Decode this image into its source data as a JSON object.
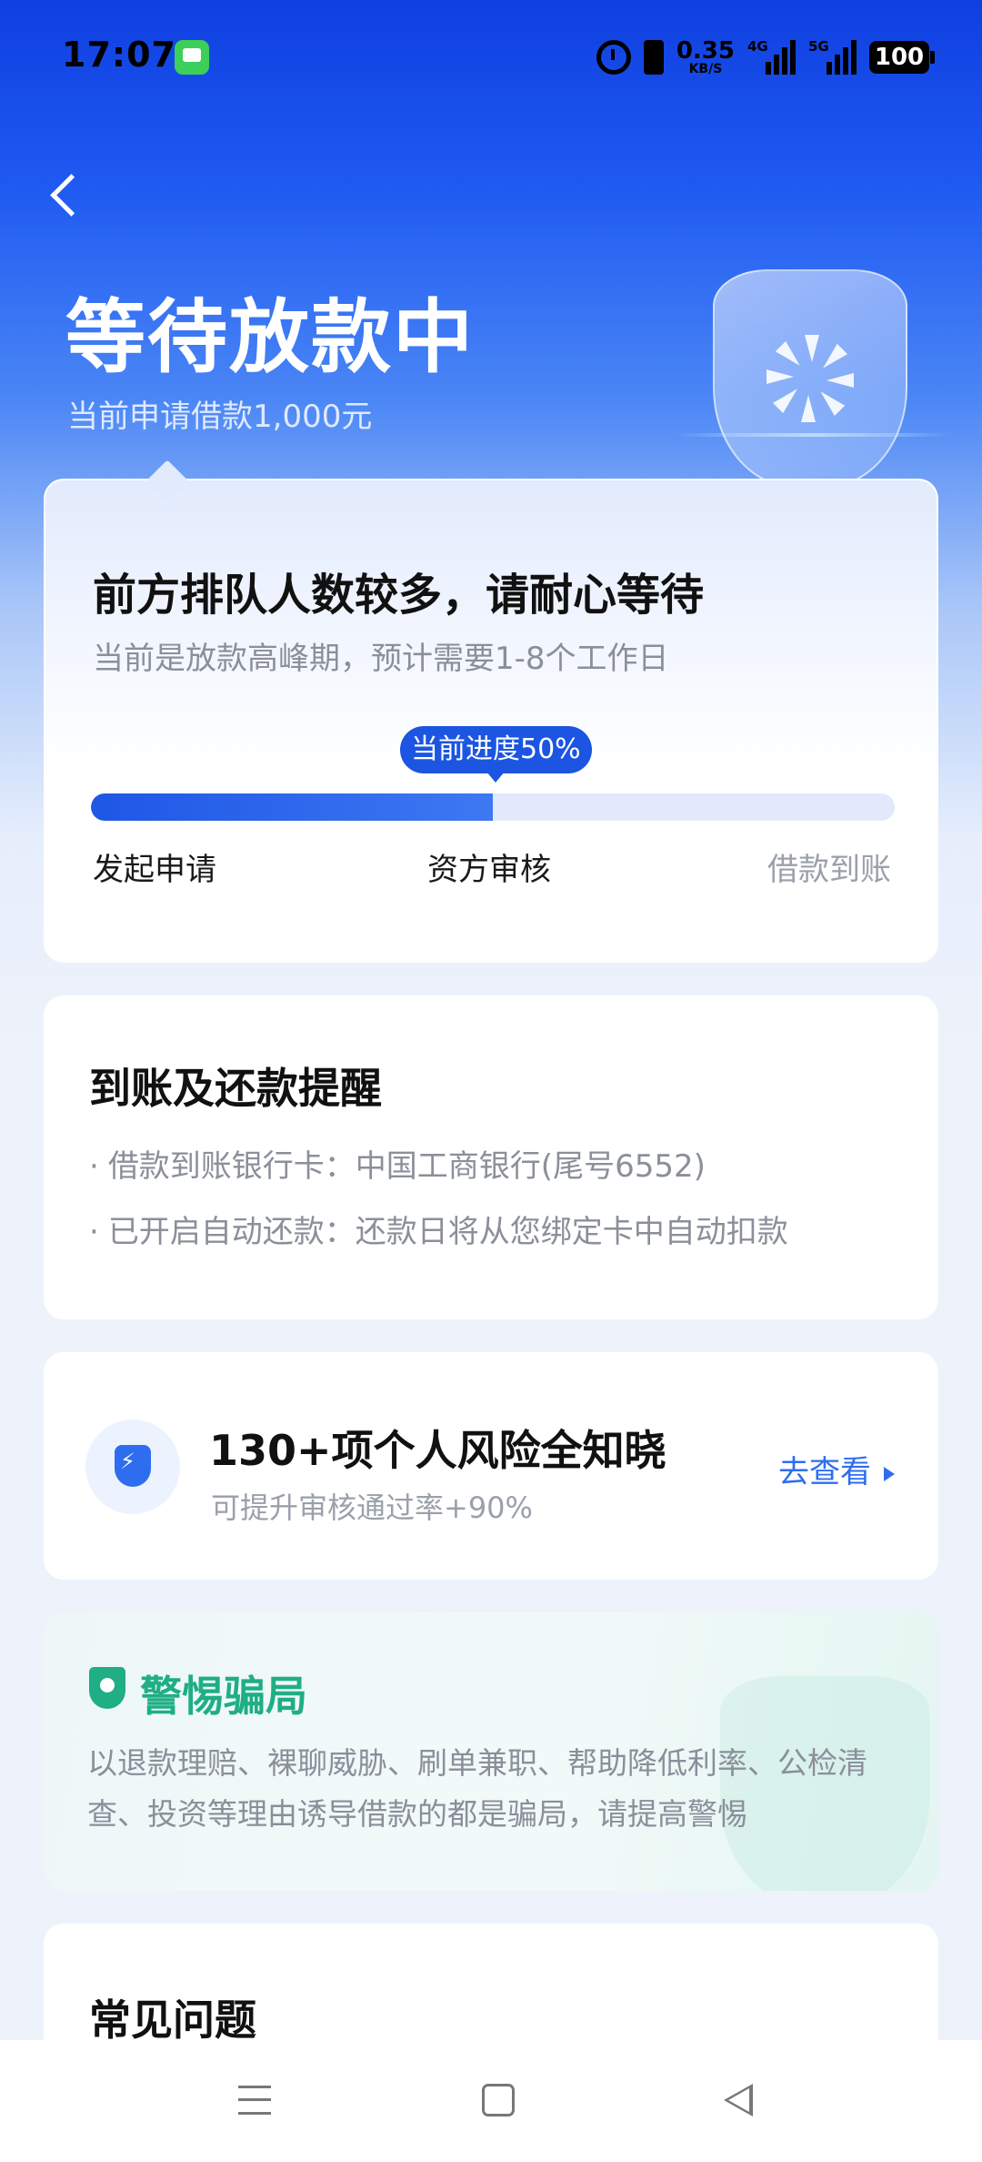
{
  "status_bar": {
    "time": "17:07",
    "net_speed_value": "0.35",
    "net_speed_unit": "KB/S",
    "signal1_label": "4G",
    "signal2_label": "5G",
    "battery": "100"
  },
  "header": {
    "title": "等待放款中",
    "subtitle": "当前申请借款1,000元"
  },
  "progress_card": {
    "title": "前方排队人数较多，请耐心等待",
    "subtitle": "当前是放款高峰期，预计需要1-8个工作日",
    "progress_label": "当前进度50%",
    "progress": 0.5,
    "steps": [
      "发起申请",
      "资方审核",
      "借款到账"
    ]
  },
  "reminder_card": {
    "title": "到账及还款提醒",
    "items": [
      "借款到账银行卡：中国工商银行(尾号6552)",
      "已开启自动还款：还款日将从您绑定卡中自动扣款"
    ]
  },
  "risk_card": {
    "title": "130+项个人风险全知晓",
    "subtitle": "可提升审核通过率+90%",
    "link": "去查看"
  },
  "fraud_card": {
    "title": "警惕骗局",
    "text": "以退款理赔、裸聊威胁、刷单兼职、帮助降低利率、公检清查、投资等理由诱导借款的都是骗局，请提高警惕"
  },
  "faq_card": {
    "title": "常见问题"
  },
  "colors": {
    "primary": "#1b55e2",
    "fraud_green": "#1fae85",
    "link_blue": "#2f6df0"
  }
}
